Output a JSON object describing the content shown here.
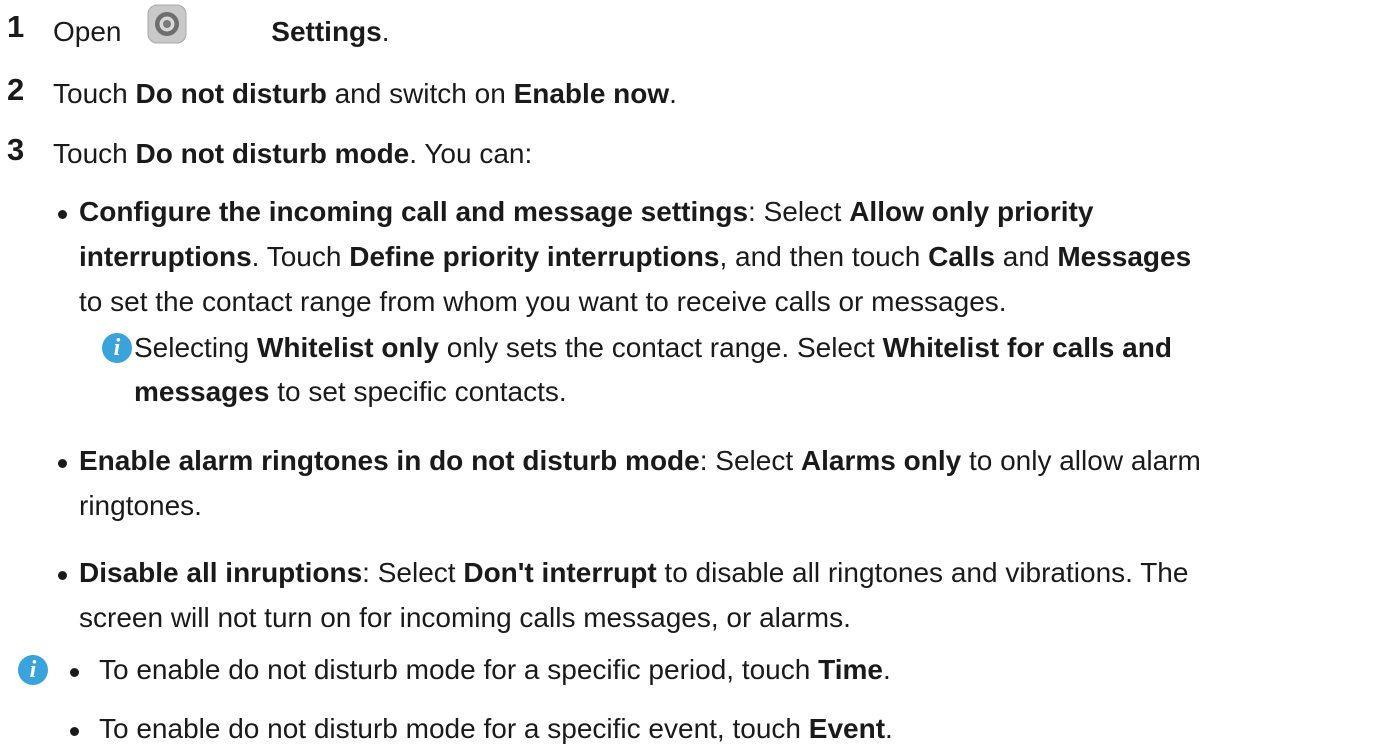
{
  "steps": {
    "s1": {
      "num": "1",
      "open": "Open ",
      "settings": "Settings",
      "end": "."
    },
    "s2": {
      "num": "2",
      "a": "Touch ",
      "b": "Do not disturb",
      "c": " and switch on ",
      "d": "Enable now",
      "e": "."
    },
    "s3": {
      "num": "3",
      "a": "Touch ",
      "b": "Do not disturb mode",
      "c": ". You can:"
    }
  },
  "bullet1": {
    "l1": {
      "a": "Configure the incoming call and message settings",
      "b": ": Select ",
      "c": "Allow only priority"
    },
    "l2": {
      "a": "interruptions",
      "b": ". Touch ",
      "c": "Define priority interruptions",
      "d": ", and then touch ",
      "e": "Calls",
      "f": " and ",
      "g": "Messages"
    },
    "l3": "to set the contact range from whom you want to receive calls or messages."
  },
  "note1": {
    "l1": {
      "a": "Selecting ",
      "b": "Whitelist only",
      "c": " only sets the contact range. Select ",
      "d": "Whitelist for calls and"
    },
    "l2": {
      "a": "messages",
      "b": " to set specific contacts."
    }
  },
  "bullet2": {
    "l1": {
      "a": "Enable alarm ringtones in do not disturb mode",
      "b": ": Select ",
      "c": "Alarms only",
      "d": " to only allow alarm"
    },
    "l2": "ringtones."
  },
  "bullet3": {
    "l1": {
      "a": "Disable all inruptions",
      "b": ": Select ",
      "c": "Don't interrupt",
      "d": " to disable all ringtones and vibrations. The"
    },
    "l2": "screen will not turn on for incoming calls messages, or alarms."
  },
  "tips": {
    "t1": {
      "a": "To enable do not disturb mode for a specific period, touch ",
      "b": "Time",
      "c": "."
    },
    "t2": {
      "a": "To enable do not disturb mode for a specific event, touch ",
      "b": "Event",
      "c": "."
    }
  },
  "icons": {
    "settings": "settings-gear-icon",
    "info": "info-icon",
    "info_glyph": "i"
  },
  "colors": {
    "text": "#1a1a1a",
    "info_blue": "#3aa3dc"
  }
}
